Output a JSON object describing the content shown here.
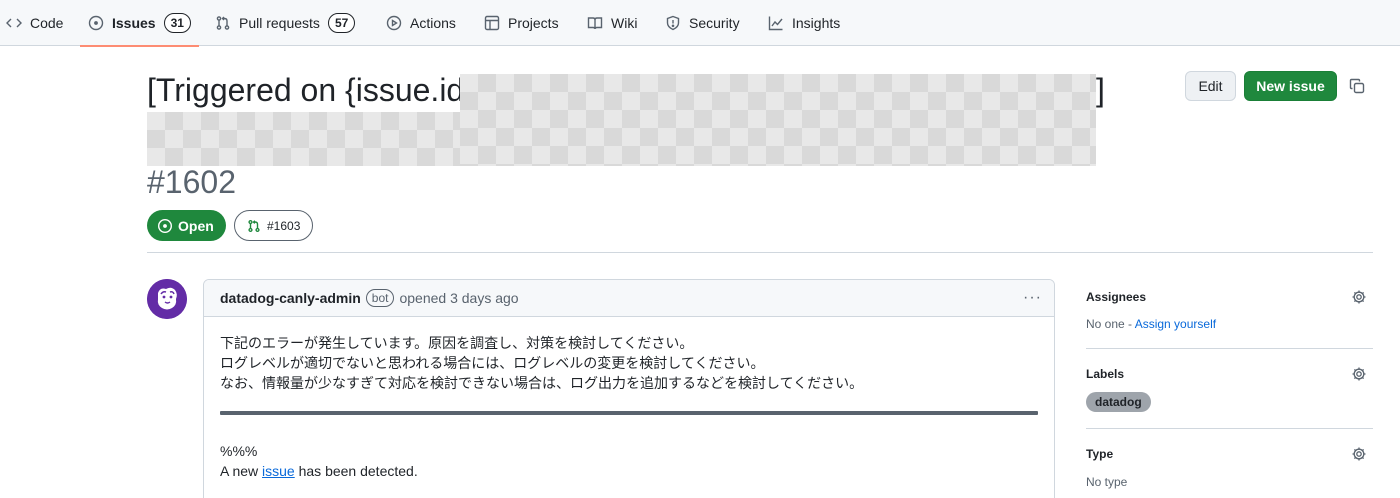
{
  "repo_nav": {
    "tabs": [
      {
        "label": "Code",
        "icon": "code-icon"
      },
      {
        "label": "Issues",
        "icon": "issue-opened-icon",
        "count": "31"
      },
      {
        "label": "Pull requests",
        "icon": "git-pull-request-icon",
        "count": "57"
      },
      {
        "label": "Actions",
        "icon": "play-icon"
      },
      {
        "label": "Projects",
        "icon": "table-icon"
      },
      {
        "label": "Wiki",
        "icon": "book-icon"
      },
      {
        "label": "Security",
        "icon": "shield-icon"
      },
      {
        "label": "Insights",
        "icon": "graph-icon"
      }
    ],
    "active_tab": "Issues"
  },
  "issue": {
    "title_visible_start": "[Triggered on {issue.id:",
    "title_visible_end": "]",
    "title_redacted": true,
    "number": "#1602",
    "state": "Open",
    "linked_pr": "#1603",
    "edit_label": "Edit",
    "new_issue_label": "New issue"
  },
  "comment": {
    "author": "datadog-canly-admin",
    "bot_badge": "bot",
    "meta": "opened 3 days ago",
    "menu": "···",
    "lines": [
      "下記のエラーが発生しています。原因を調査し、対策を検討してください。",
      "ログレベルが適切でないと思われる場合には、ログレベルの変更を検討してください。",
      "なお、情報量が少なすぎて対応を検討できない場合は、ログ出力を追加するなどを検討してください。"
    ],
    "percent_line": "%%%",
    "detected_prefix": "A new ",
    "detected_link": "issue",
    "detected_suffix": " has been detected."
  },
  "sidebar": {
    "assignees_heading": "Assignees",
    "assignees_value": "No one - ",
    "assign_yourself": "Assign yourself",
    "labels_heading": "Labels",
    "label_chip": "datadog",
    "type_heading": "Type",
    "type_value": "No type"
  },
  "colors": {
    "open_green": "#1f883d",
    "accent_underline": "#fd8c73",
    "link_blue": "#0969da",
    "datadog_purple": "#632ca6"
  }
}
